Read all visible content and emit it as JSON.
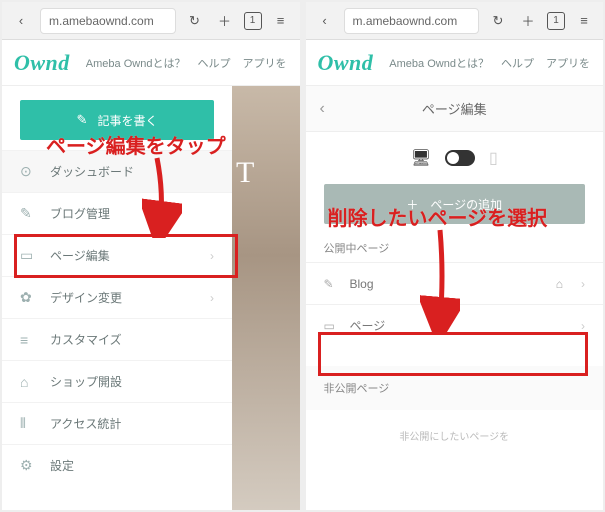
{
  "chrome": {
    "url": "m.amebaownd.com",
    "tab_count": "1"
  },
  "header": {
    "logo": "Ownd",
    "links": [
      "Ameba Owndとは？",
      "ヘルプ",
      "アプリを"
    ]
  },
  "left": {
    "write_label": "記事を書く",
    "items": [
      {
        "icon": "⊙",
        "label": "ダッシュボード"
      },
      {
        "icon": "✎",
        "label": "ブログ管理"
      },
      {
        "icon": "▭",
        "label": "ページ編集"
      },
      {
        "icon": "✿",
        "label": "デザイン変更"
      },
      {
        "icon": "≡",
        "label": "カスタマイズ"
      },
      {
        "icon": "⌂",
        "label": "ショップ開設"
      },
      {
        "icon": "⫴",
        "label": "アクセス統計"
      },
      {
        "icon": "⚙",
        "label": "設定"
      }
    ],
    "annotation": "ページ編集をタップ"
  },
  "right": {
    "title": "ページ編集",
    "add_label": "ページの追加",
    "public_label": "公開中ページ",
    "pages": [
      {
        "icon": "✎",
        "label": "Blog",
        "home": true
      },
      {
        "icon": "▭",
        "label": "ページ",
        "home": false
      }
    ],
    "private_label": "非公開ページ",
    "private_note": "非公開にしたいページを",
    "annotation": "削除したいページを選択"
  }
}
